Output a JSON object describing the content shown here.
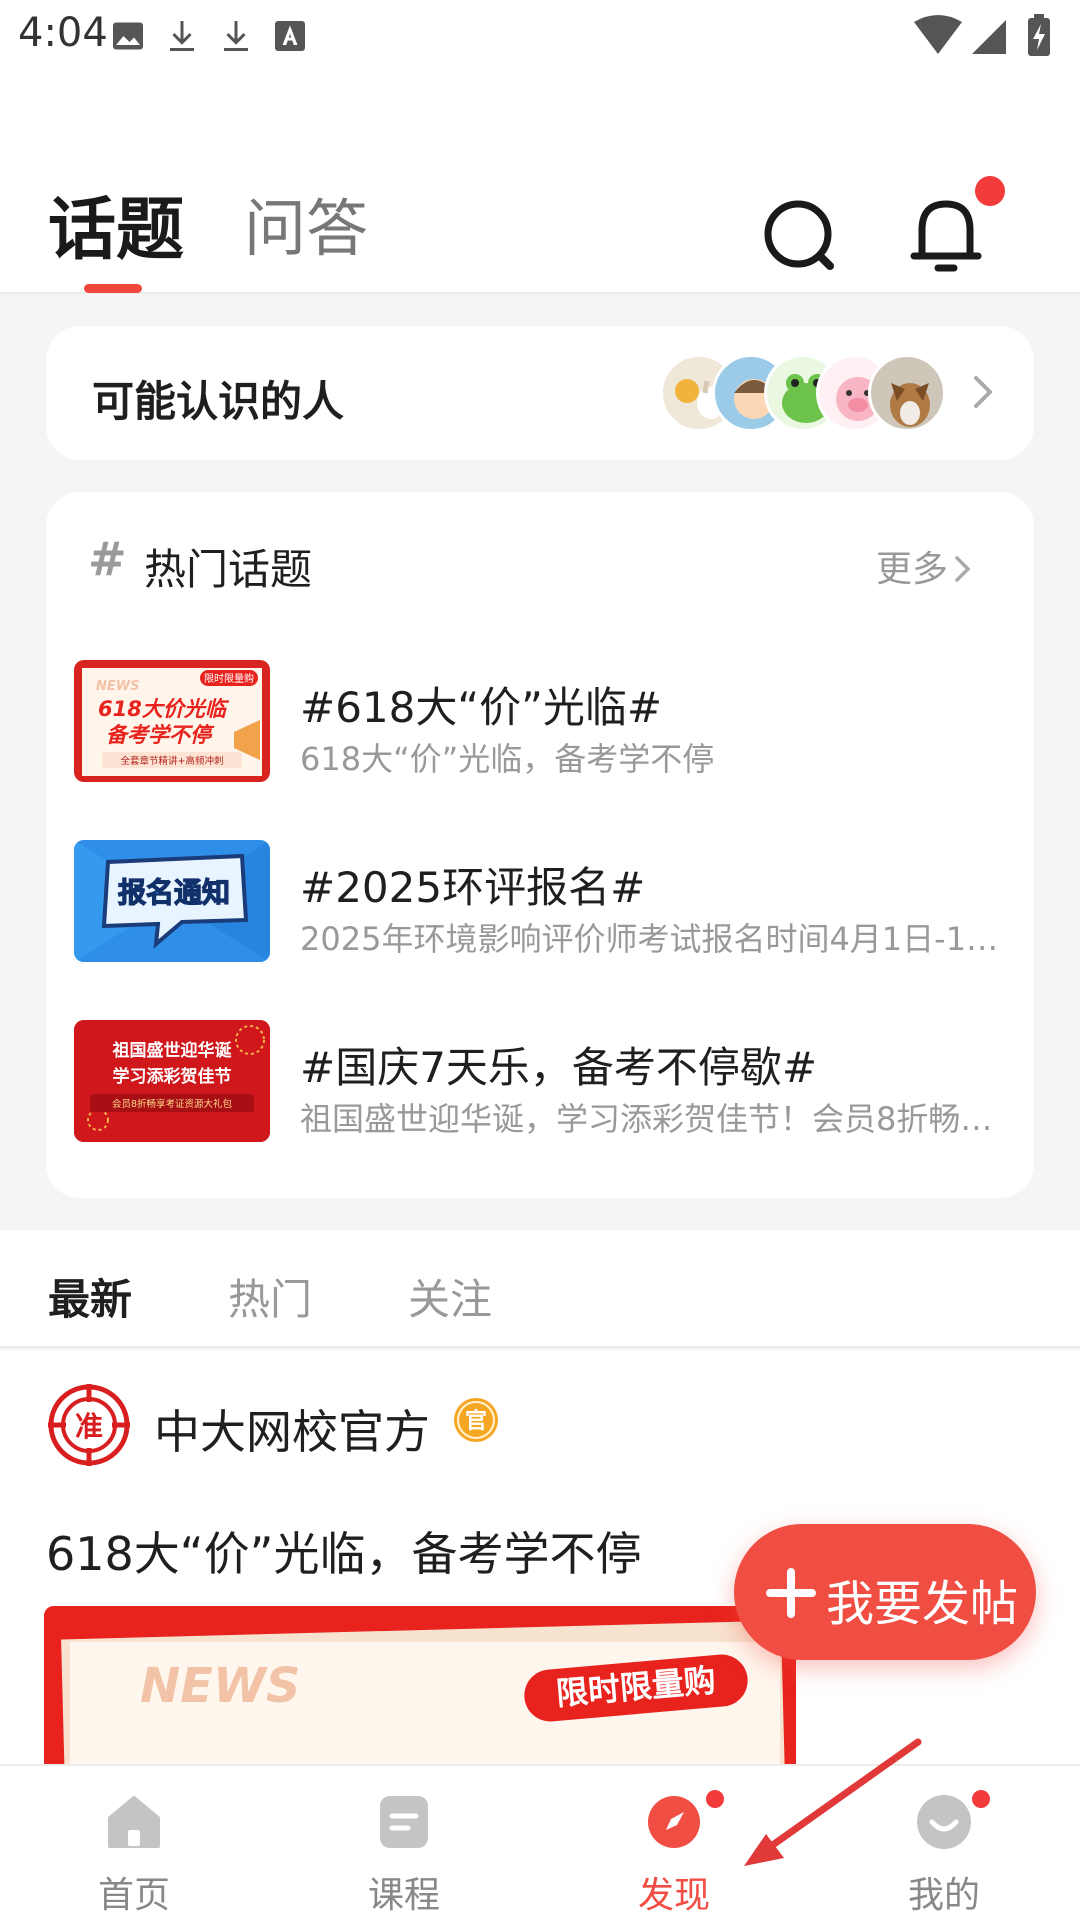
{
  "status_bar": {
    "time": "4:04",
    "icons": [
      "image-icon",
      "download-icon",
      "download-icon",
      "font-icon",
      "wifi-icon",
      "signal-icon",
      "battery-charging-icon"
    ]
  },
  "header": {
    "tabs": [
      {
        "label": "话题",
        "active": true
      },
      {
        "label": "问答",
        "active": false
      }
    ],
    "icons": [
      "search-icon",
      "bell-icon"
    ]
  },
  "people": {
    "title": "可能认识的人"
  },
  "hot_topics": {
    "hash": "#",
    "title": "热门话题",
    "more": "更多",
    "items": [
      {
        "title": "#618大“价”光临#",
        "subtitle": "618大“价”光临，备考学不停",
        "thumb": {
          "tag": "限时限量购",
          "news": "NEWS",
          "line1": "618大价光临",
          "line2": "备考学不停",
          "line3": "全套章节精讲+高频冲刺"
        }
      },
      {
        "title": "#2025环评报名#",
        "subtitle": "2025年环境影响评价师考试报名时间4月1日-1…",
        "thumb": {
          "line1": "报名通知"
        }
      },
      {
        "title": "#国庆7天乐，备考不停歇#",
        "subtitle": "祖国盛世迎华诞，学习添彩贺佳节！会员8折畅…",
        "thumb": {
          "line1": "祖国盛世迎华诞",
          "line2": "学习添彩贺佳节",
          "line3": "会员8折畅享考证资源大礼包"
        }
      }
    ]
  },
  "feed_tabs": [
    {
      "label": "最新",
      "active": true
    },
    {
      "label": "热门",
      "active": false
    },
    {
      "label": "关注",
      "active": false
    }
  ],
  "post": {
    "author": "中大网校官方",
    "badge": "官",
    "logo_char": "准",
    "text": "618大“价”光临，备考学不停",
    "image": {
      "news": "NEWS",
      "tag": "限时限量购"
    }
  },
  "fab": {
    "label": "我要发帖"
  },
  "bottom_nav": [
    {
      "label": "首页",
      "icon": "home-icon",
      "active": false,
      "dot": false
    },
    {
      "label": "课程",
      "icon": "course-icon",
      "active": false,
      "dot": false
    },
    {
      "label": "发现",
      "icon": "discover-icon",
      "active": true,
      "dot": true
    },
    {
      "label": "我的",
      "icon": "profile-icon",
      "active": false,
      "dot": true
    }
  ],
  "colors": {
    "accent": "#f04d43",
    "notification": "#f23c3c",
    "text_primary": "#1f1f1f",
    "text_secondary": "#999999",
    "page_bg": "#f5f5f5"
  }
}
